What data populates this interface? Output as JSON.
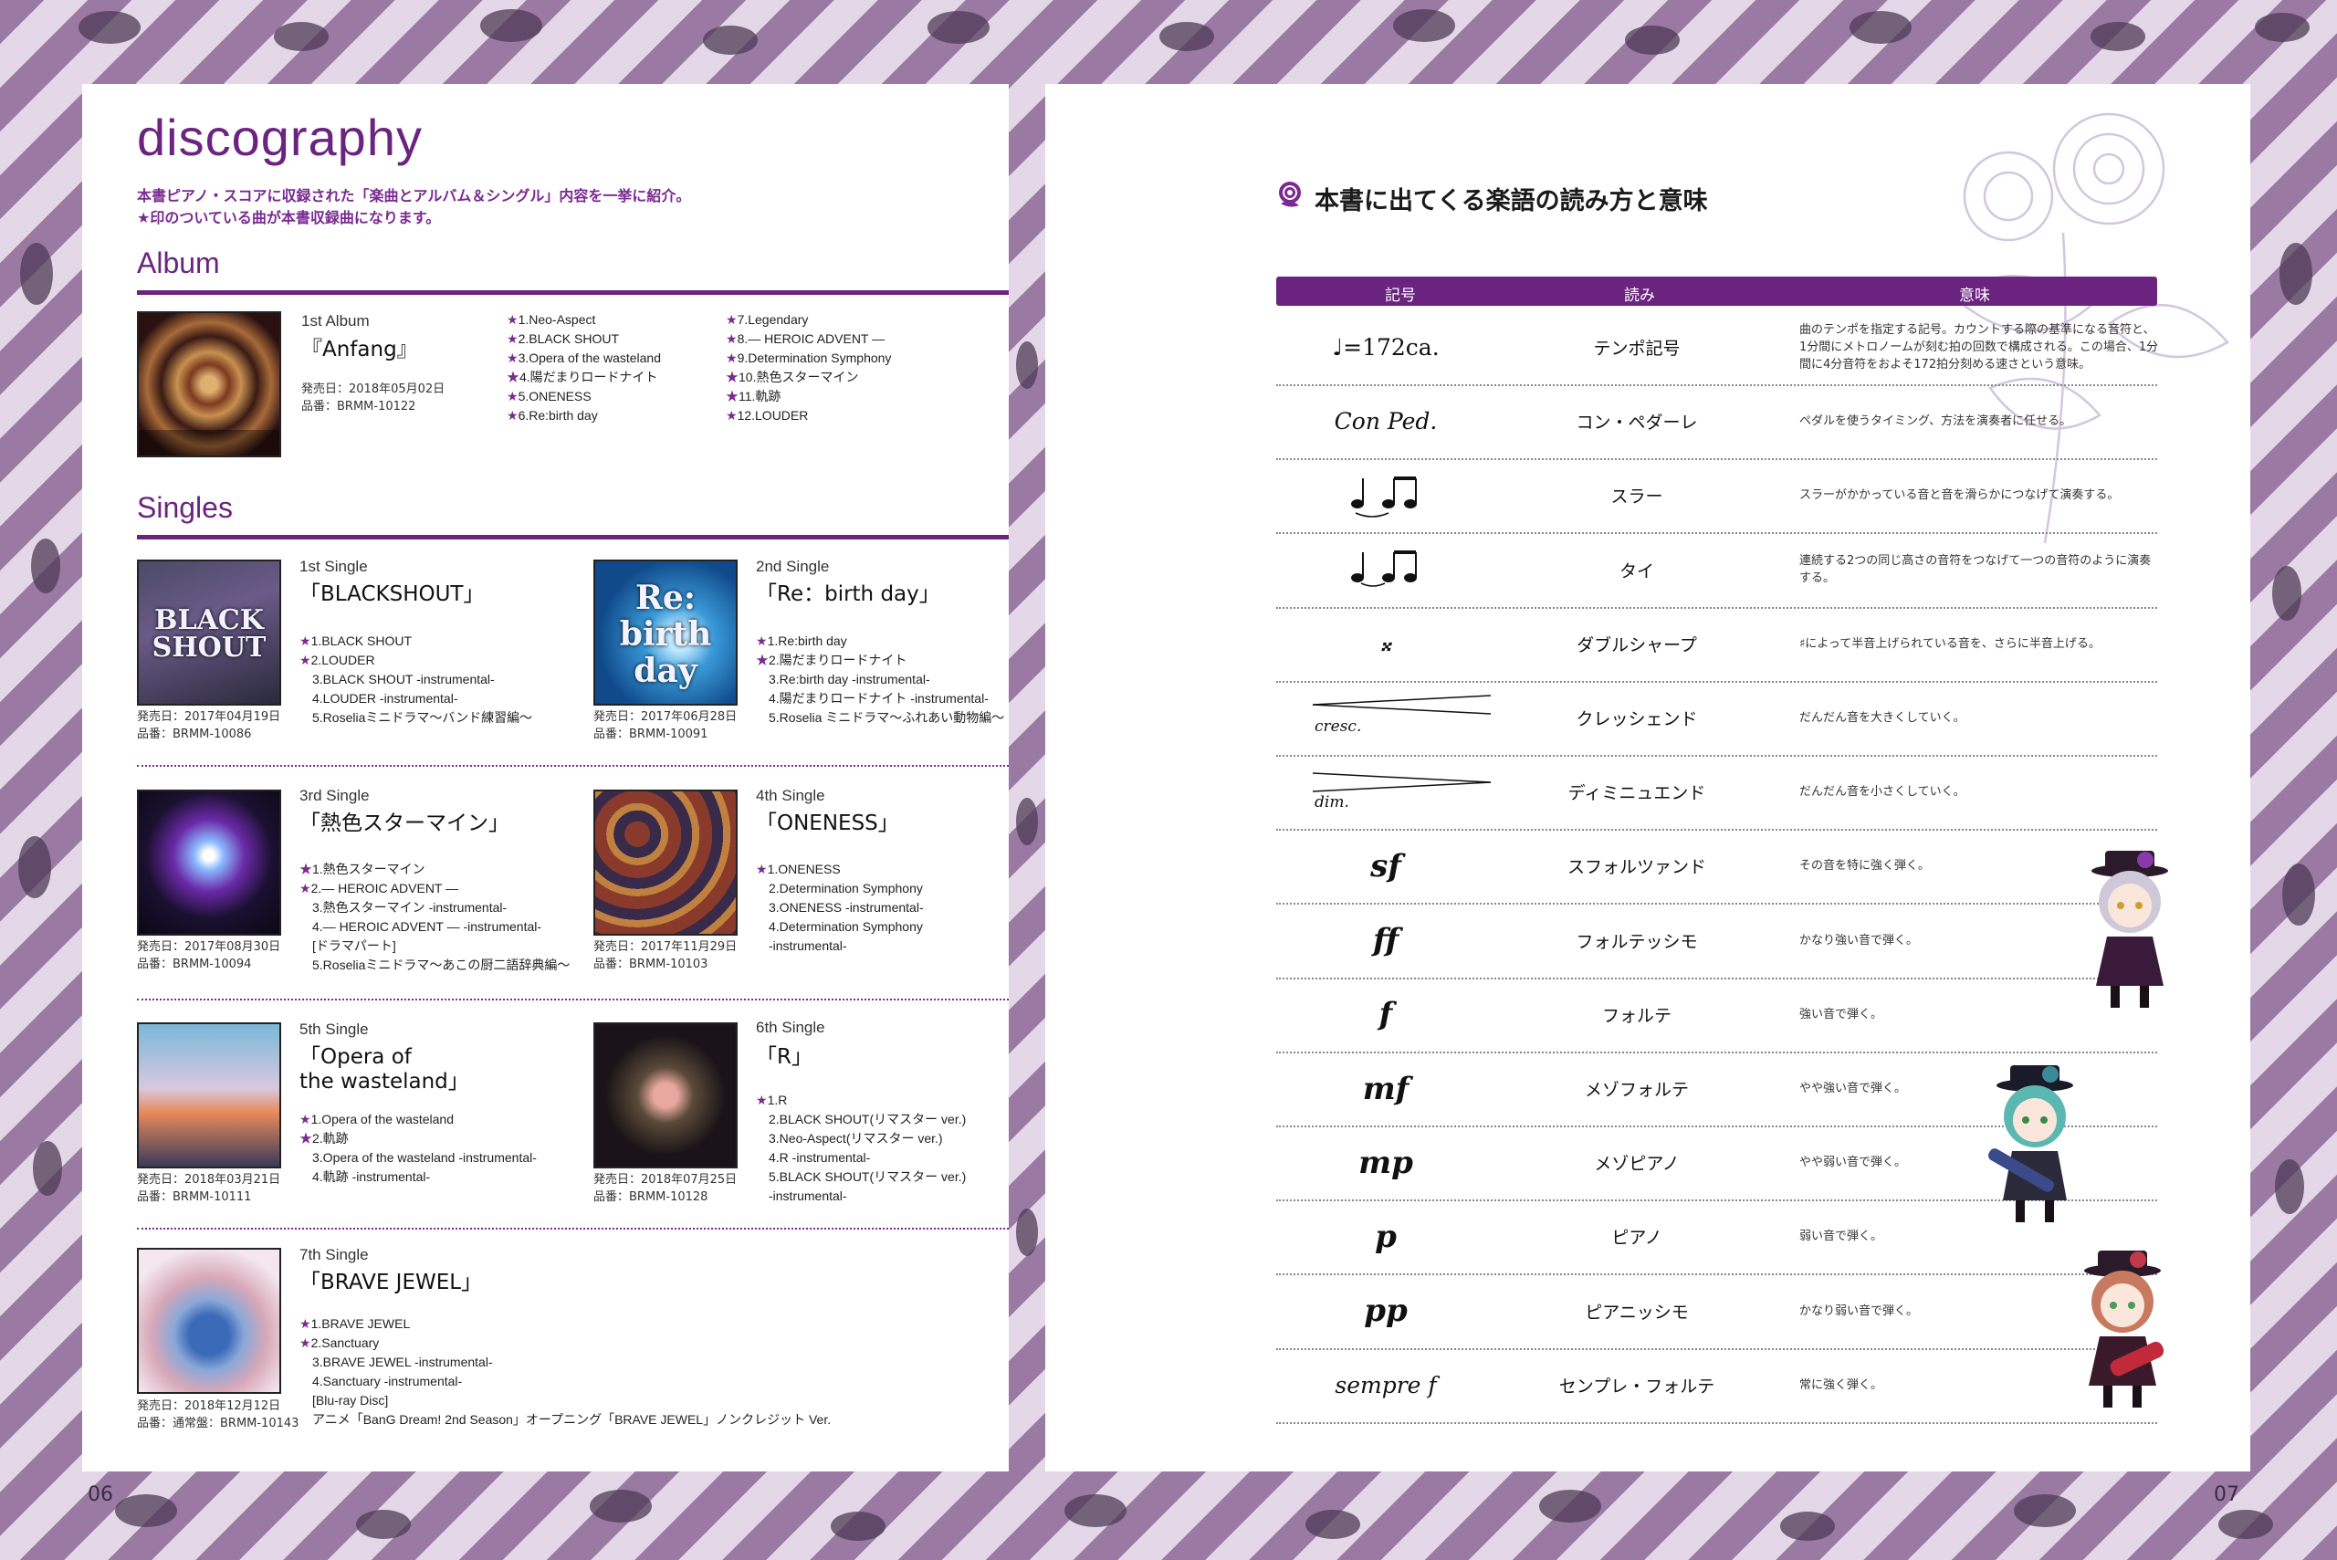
{
  "left": {
    "title": "discography",
    "intro_1": "本書ピアノ・スコアに収録された「楽曲とアルバム＆シングル」内容を一挙に紹介。",
    "intro_2": "★印のついている曲が本書収録曲になります。",
    "album_heading": "Album",
    "singles_heading": "Singles",
    "page_number": "06"
  },
  "album": {
    "kind": "1st Album",
    "title": "『Anfang』",
    "release": "発売日：2018年05月02日",
    "catalog": "品番：BRMM-10122",
    "tracks_a": [
      "★1.Neo-Aspect",
      "★2.BLACK SHOUT",
      "★3.Opera of the wasteland",
      "★4.陽だまりロードナイト",
      "★5.ONENESS",
      "★6.Re:birth day"
    ],
    "tracks_b": [
      "★7.Legendary",
      "★8.― HEROIC ADVENT ―",
      "★9.Determination Symphony",
      "★10.熱色スターマイン",
      "★11.軌跡",
      "★12.LOUDER"
    ]
  },
  "singles": [
    {
      "kind": "1st Single",
      "title": "「BLACKSHOUT」",
      "cover_text": "BLACK SHOUT",
      "release": "発売日：2017年04月19日",
      "catalog": "品番：BRMM-10086",
      "tracks": [
        "★1.BLACK SHOUT",
        "★2.LOUDER",
        "3.BLACK SHOUT -instrumental-",
        "4.LOUDER -instrumental-",
        "5.Roseliaミニドラマ～バンド練習編～"
      ]
    },
    {
      "kind": "2nd Single",
      "title": "「Re：birth day」",
      "cover_text": "Re: birth day",
      "release": "発売日：2017年06月28日",
      "catalog": "品番：BRMM-10091",
      "tracks": [
        "★1.Re:birth day",
        "★2.陽だまりロードナイト",
        "3.Re:birth day -instrumental-",
        "4.陽だまりロードナイト -instrumental-",
        "5.Roselia ミニドラマ～ふれあい動物編～"
      ]
    },
    {
      "kind": "3rd Single",
      "title": "「熱色スターマイン」",
      "cover_text": "",
      "release": "発売日：2017年08月30日",
      "catalog": "品番：BRMM-10094",
      "tracks": [
        "★1.熱色スターマイン",
        "★2.― HEROIC ADVENT ―",
        "3.熱色スターマイン -instrumental-",
        "4.― HEROIC ADVENT ― -instrumental-",
        "[ドラマパート]",
        "5.Roseliaミニドラマ～あこの厨二語辞典編～"
      ]
    },
    {
      "kind": "4th Single",
      "title": "「ONENESS」",
      "cover_text": "",
      "release": "発売日：2017年11月29日",
      "catalog": "品番：BRMM-10103",
      "tracks": [
        "★1.ONENESS",
        "2.Determination Symphony",
        "3.ONENESS -instrumental-",
        "4.Determination Symphony",
        "-instrumental-"
      ]
    },
    {
      "kind": "5th Single",
      "title": "「Opera of the wasteland」",
      "title_l1": "「Opera of",
      "title_l2": "the wasteland」",
      "cover_text": "",
      "release": "発売日：2018年03月21日",
      "catalog": "品番：BRMM-10111",
      "tracks": [
        "★1.Opera of the wasteland",
        "★2.軌跡",
        "3.Opera of the wasteland -instrumental-",
        "4.軌跡 -instrumental-"
      ]
    },
    {
      "kind": "6th Single",
      "title": "「R」",
      "cover_text": "",
      "release": "発売日：2018年07月25日",
      "catalog": "品番：BRMM-10128",
      "tracks": [
        "★1.R",
        "2.BLACK SHOUT(リマスター ver.)",
        "3.Neo-Aspect(リマスター ver.)",
        "4.R -instrumental-",
        "5.BLACK SHOUT(リマスター ver.)",
        "-instrumental-"
      ]
    },
    {
      "kind": "7th Single",
      "title": "「BRAVE JEWEL」",
      "cover_text": "",
      "release": "発売日：2018年12月12日",
      "catalog": "品番：通常盤：BRMM-10143",
      "tracks": [
        "★1.BRAVE JEWEL",
        "★2.Sanctuary",
        "3.BRAVE JEWEL -instrumental-",
        "4.Sanctuary -instrumental-",
        "[Blu-ray Disc]",
        "アニメ「BanG Dream! 2nd Season」オープニング「BRAVE JEWEL」ノンクレジット Ver."
      ]
    }
  ],
  "right": {
    "title": "本書に出てくる楽語の読み方と意味",
    "col_symbol": "記号",
    "col_reading": "読み",
    "col_meaning": "意味",
    "page_number": "07",
    "icon": "rose-icon"
  },
  "glossary": [
    {
      "symbol": "♩=172ca.",
      "reading": "テンポ記号",
      "meaning": "曲のテンポを指定する記号。カウントする際の基準になる音符と、1分間にメトロノームが刻む拍の回数で構成される。この場合、1分間に4分音符をおよそ172拍分刻める速さという意味。"
    },
    {
      "symbol": "Con Ped.",
      "reading": "コン・ペダーレ",
      "meaning": "ペダルを使うタイミング、方法を演奏者に任せる。"
    },
    {
      "symbol": "",
      "reading": "スラー",
      "meaning": "スラーがかかっている音と音を滑らかにつなげて演奏する。"
    },
    {
      "symbol": "",
      "reading": "タイ",
      "meaning": "連続する2つの同じ高さの音符をつなげて一つの音符のように演奏する。"
    },
    {
      "symbol": "𝄪",
      "reading": "ダブルシャープ",
      "meaning": "♯によって半音上げられている音を、さらに半音上げる。"
    },
    {
      "symbol": "cresc.",
      "reading": "クレッシェンド",
      "meaning": "だんだん音を大きくしていく。"
    },
    {
      "symbol": "dim.",
      "reading": "ディミニュエンド",
      "meaning": "だんだん音を小さくしていく。"
    },
    {
      "symbol": "sf",
      "reading": "スフォルツァンド",
      "meaning": "その音を特に強く弾く。"
    },
    {
      "symbol": "ff",
      "reading": "フォルテッシモ",
      "meaning": "かなり強い音で弾く。"
    },
    {
      "symbol": "f",
      "reading": "フォルテ",
      "meaning": "強い音で弾く。"
    },
    {
      "symbol": "mf",
      "reading": "メゾフォルテ",
      "meaning": "やや強い音で弾く。"
    },
    {
      "symbol": "mp",
      "reading": "メゾピアノ",
      "meaning": "やや弱い音で弾く。"
    },
    {
      "symbol": "p",
      "reading": "ピアノ",
      "meaning": "弱い音で弾く。"
    },
    {
      "symbol": "pp",
      "reading": "ピアニッシモ",
      "meaning": "かなり弱い音で弾く。"
    },
    {
      "symbol": "sempre f",
      "reading": "センプレ・フォルテ",
      "meaning": "常に強く弾く。"
    }
  ],
  "colors": {
    "accent": "#6a2480",
    "stripe_dark": "#9a7aa2",
    "stripe_light": "#e4d8e8",
    "ivy": "#4d3b55"
  }
}
